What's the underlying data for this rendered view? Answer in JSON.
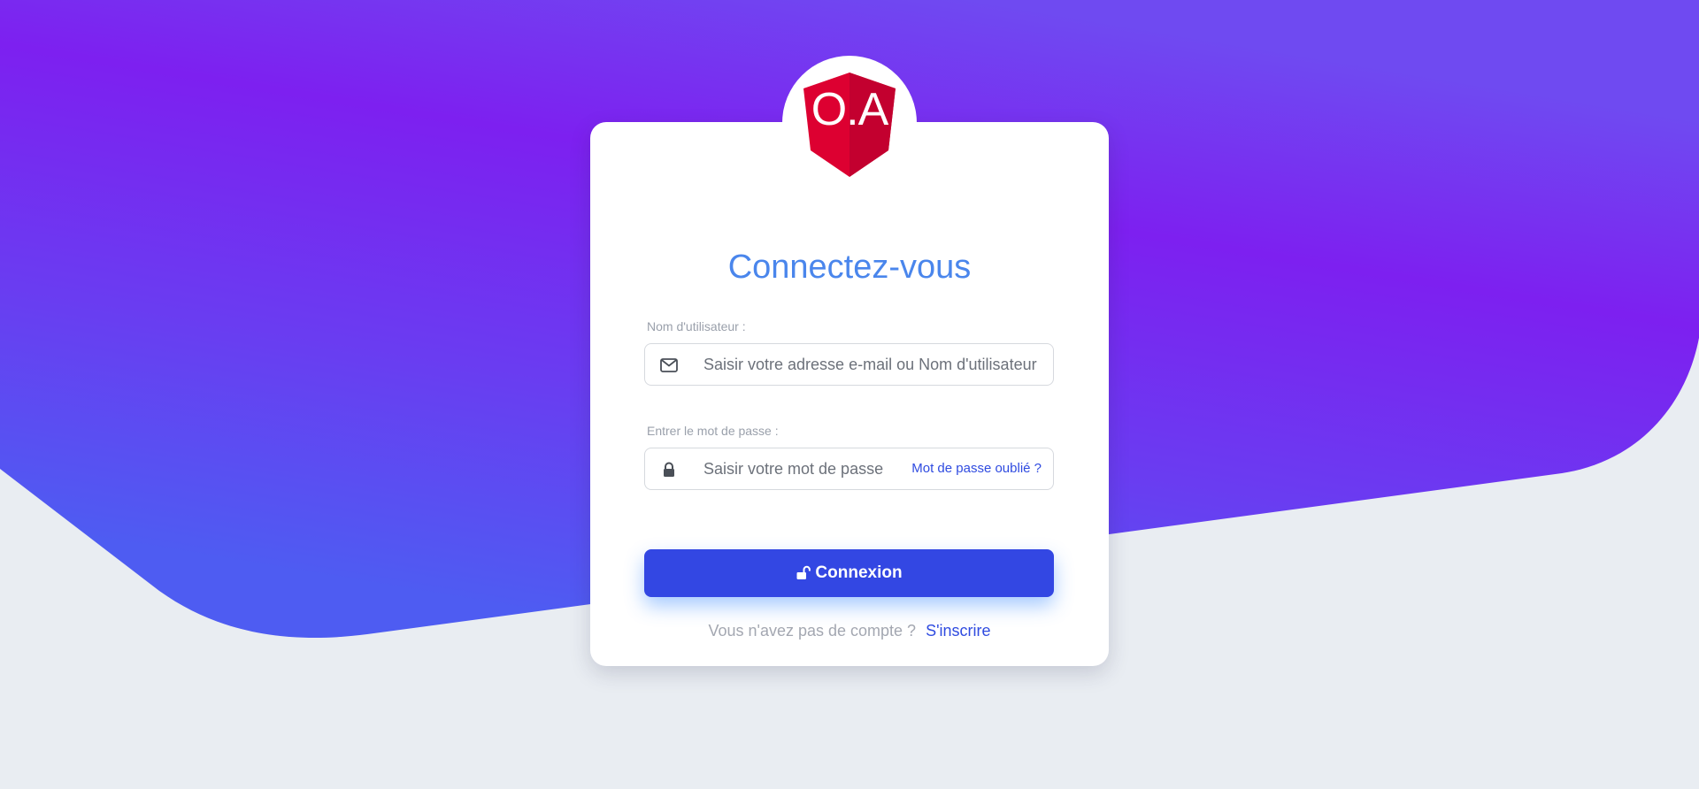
{
  "brand": {
    "logo_text": "O.A",
    "logo_color": "#dd0031"
  },
  "colors": {
    "gradient_top": "#7d20f0",
    "gradient_bottom": "#4e5cf2",
    "accent": "#3347e3",
    "title": "#4a86ec"
  },
  "login": {
    "title": "Connectez-vous",
    "username": {
      "label": "Nom d'utilisateur :",
      "placeholder": "Saisir votre adresse e-mail ou Nom d'utilisateur",
      "value": "",
      "icon": "envelope-icon"
    },
    "password": {
      "label": "Entrer le mot de passe :",
      "placeholder": "Saisir votre mot de passe",
      "value": "",
      "icon": "lock-icon",
      "forgot_link": "Mot de passe oublié ?"
    },
    "submit": {
      "label": "Connexion",
      "icon": "unlock-icon"
    },
    "signup": {
      "text": "Vous n'avez pas de compte ?",
      "link": "S'inscrire"
    }
  }
}
